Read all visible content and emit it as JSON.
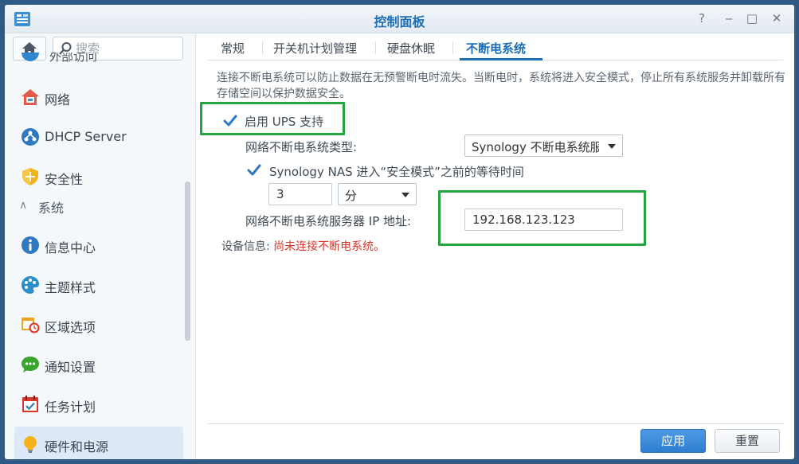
{
  "window": {
    "title": "控制面板",
    "controls": {
      "help": "?",
      "minimize": "‒",
      "maximize": "□",
      "close": "✕"
    }
  },
  "sidebar": {
    "search_placeholder": "搜索",
    "cut_item_label": "外部访问",
    "items_top": [
      {
        "label": "网络",
        "icon": "network-house-icon"
      },
      {
        "label": "DHCP Server",
        "icon": "dhcp-server-icon"
      },
      {
        "label": "安全性",
        "icon": "security-shield-icon"
      }
    ],
    "section": {
      "label": "系统",
      "chevron": "∧"
    },
    "items_system": [
      {
        "label": "信息中心",
        "icon": "info-icon"
      },
      {
        "label": "主题样式",
        "icon": "palette-icon"
      },
      {
        "label": "区域选项",
        "icon": "region-calendar-icon"
      },
      {
        "label": "通知设置",
        "icon": "chat-bubble-icon"
      },
      {
        "label": "任务计划",
        "icon": "task-calendar-icon"
      },
      {
        "label": "硬件和电源",
        "icon": "lightbulb-icon",
        "active": true
      }
    ]
  },
  "tabs": [
    {
      "label": "常规"
    },
    {
      "label": "开关机计划管理"
    },
    {
      "label": "硬盘休眠"
    },
    {
      "label": "不断电系统",
      "active": true
    }
  ],
  "content": {
    "description": "连接不断电系统可以防止数据在无预警断电时流失。当断电时，系统将进入安全模式，停止所有系统服务并卸载所有存储空间以保护数据安全。",
    "enable_ups": {
      "label": "启用 UPS 支持",
      "checked": true
    },
    "ups_type": {
      "label": "网络不断电系统类型:",
      "value": "Synology 不断电系统服务器"
    },
    "wait_time": {
      "label": "Synology NAS 进入“安全模式”之前的等待时间",
      "checked": true,
      "value": "3",
      "unit": "分"
    },
    "server_ip": {
      "label": "网络不断电系统服务器 IP 地址:",
      "value": "192.168.123.123"
    },
    "device_info": {
      "label": "设备信息:",
      "status": "尚未连接不断电系统。"
    }
  },
  "footer": {
    "apply": "应用",
    "reset": "重置"
  },
  "colors": {
    "accent": "#1d6fb8",
    "highlight": "#23a440",
    "error": "#d9362b"
  }
}
